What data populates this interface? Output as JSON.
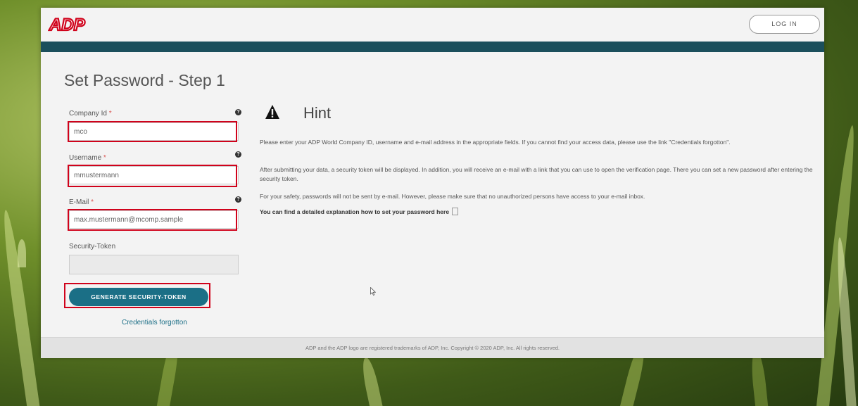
{
  "app": {
    "logo_text": "ADP"
  },
  "header": {
    "login_label": "LOG IN"
  },
  "page": {
    "title": "Set Password - Step 1"
  },
  "form": {
    "company_id": {
      "label": "Company Id",
      "required_mark": "*",
      "value": "mco",
      "help": "?"
    },
    "username": {
      "label": "Username",
      "required_mark": "*",
      "value": "mmustermann",
      "help": "?"
    },
    "email": {
      "label": "E-Mail",
      "required_mark": "*",
      "value": "max.mustermann@mcomp.sample",
      "help": "?"
    },
    "security_token": {
      "label": "Security-Token",
      "value": ""
    },
    "generate_button": "GENERATE SECURITY-TOKEN",
    "credentials_link": "Credentials forgotton"
  },
  "hint": {
    "title": "Hint",
    "paragraphs": [
      "Please enter your ADP World Company ID, username and e-mail address in the appropriate fields. If you cannot find your access data, please use the link \"Credentials forgotton\".",
      "After submitting your data, a security token will be displayed. In addition, you will receive an e-mail with a link that you can use to open the verification page. There you can set a new password after entering the security token.",
      "For your safety, passwords will not be sent by e-mail. However, please make sure that no unauthorized persons have access to your e-mail inbox."
    ],
    "explanation_link": "You can find a detailed explanation how to set your password here"
  },
  "footer": {
    "text": "ADP and the ADP logo are registered trademarks of ADP, Inc. Copyright © 2020 ADP, Inc. All rights reserved."
  },
  "icons": {
    "hint": "warning-icon",
    "help": "help-icon",
    "pdf": "pdf-icon",
    "cursor": "mouse-cursor-icon"
  },
  "colors": {
    "accent": "#1b6f86",
    "stripe": "#1b4f5c",
    "highlight": "#d0021b",
    "logo": "#d0021b"
  }
}
